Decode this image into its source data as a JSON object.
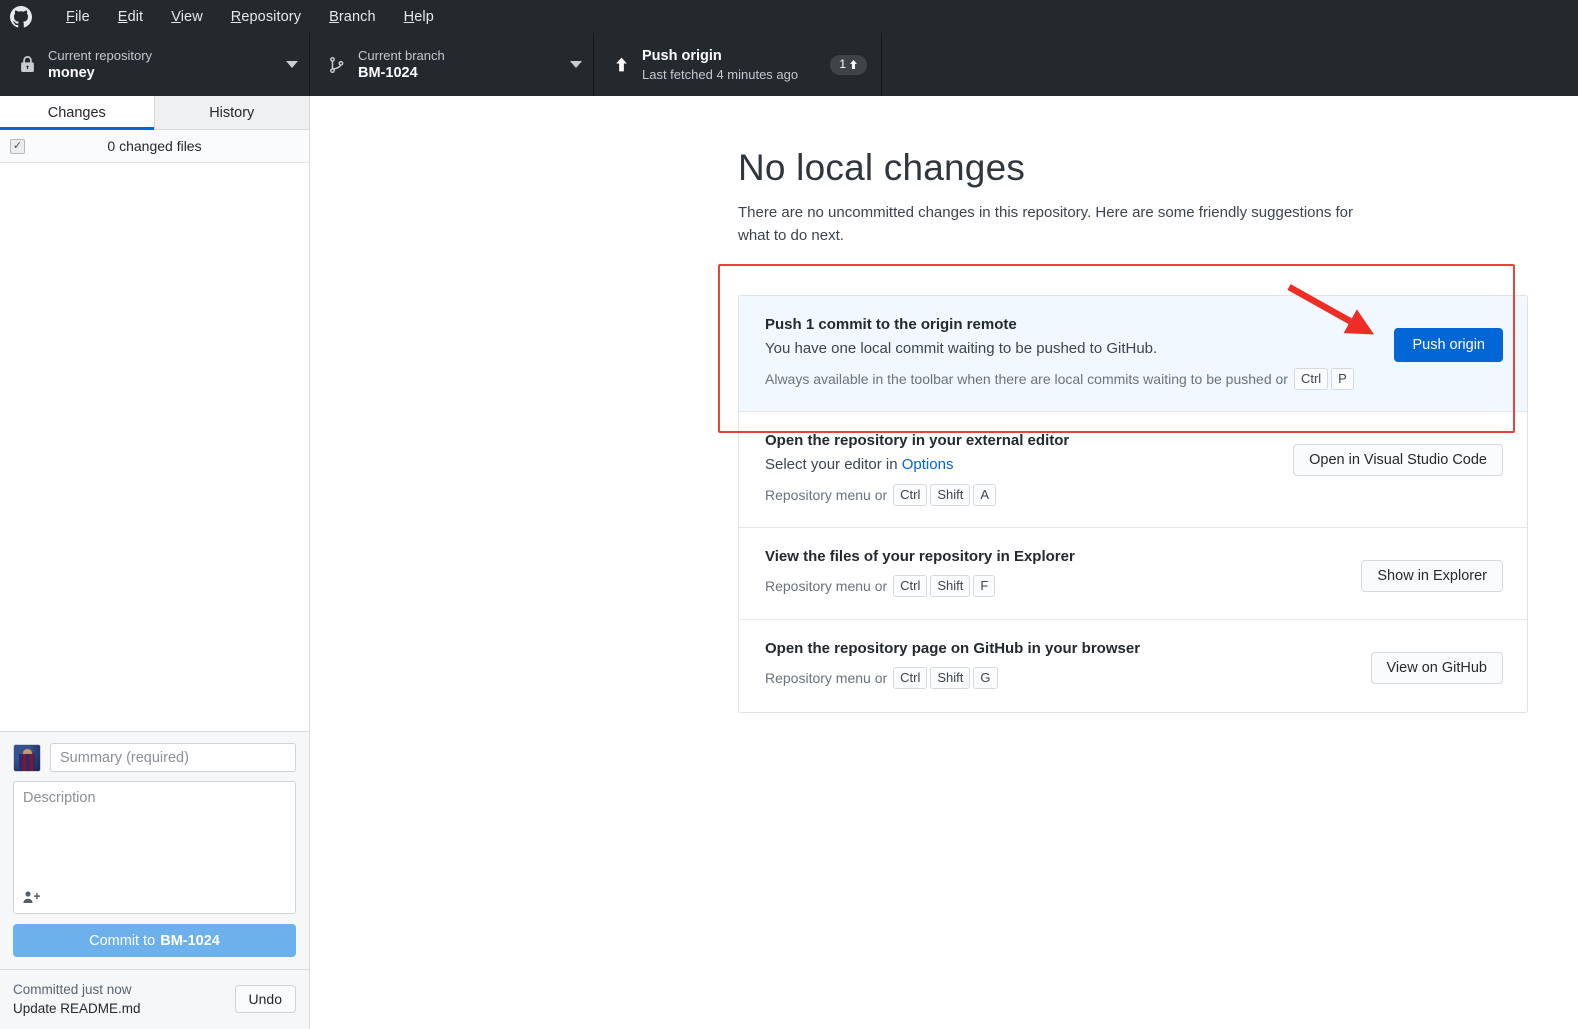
{
  "menubar": {
    "logo_icon": "github-mark-icon",
    "items": [
      {
        "label": "File",
        "mnemonic": "F",
        "rest": "ile"
      },
      {
        "label": "Edit",
        "mnemonic": "E",
        "rest": "dit"
      },
      {
        "label": "View",
        "mnemonic": "V",
        "rest": "iew"
      },
      {
        "label": "Repository",
        "mnemonic": "R",
        "rest": "epository"
      },
      {
        "label": "Branch",
        "mnemonic": "B",
        "rest": "ranch"
      },
      {
        "label": "Help",
        "mnemonic": "H",
        "rest": "elp"
      }
    ]
  },
  "toolbar": {
    "repository": {
      "icon": "lock-icon",
      "label": "Current repository",
      "value": "money",
      "caret_icon": "chevron-down-icon"
    },
    "branch": {
      "icon": "git-branch-icon",
      "label": "Current branch",
      "value": "BM-1024",
      "caret_icon": "chevron-down-icon"
    },
    "push": {
      "icon": "arrow-up-icon",
      "label": "Push origin",
      "sublabel": "Last fetched 4 minutes ago",
      "badge_count": "1",
      "badge_icon": "arrow-up-icon"
    }
  },
  "sidebar": {
    "tabs": [
      {
        "label": "Changes",
        "active": true
      },
      {
        "label": "History",
        "active": false
      }
    ],
    "changed_files": {
      "checkbox_state": "checked",
      "label": "0 changed files"
    },
    "commit_form": {
      "avatar_alt": "user-avatar",
      "summary_placeholder": "Summary (required)",
      "summary_value": "",
      "description_placeholder": "Description",
      "description_value": "",
      "coauthor_icon": "add-person-icon",
      "commit_button_prefix": "Commit to ",
      "commit_button_branch": "BM-1024"
    },
    "undo_bar": {
      "status": "Committed just now",
      "commit_message": "Update README.md",
      "undo_label": "Undo"
    }
  },
  "main": {
    "title": "No local changes",
    "subtitle": "There are no uncommitted changes in this repository. Here are some friendly suggestions for what to do next.",
    "illustration_name": "empty-boxes-illustration",
    "suggestions": [
      {
        "title": "Push 1 commit to the origin remote",
        "description": "You have one local commit waiting to be pushed to GitHub.",
        "hint_prefix": "Always available in the toolbar when there are local commits waiting to be pushed or",
        "hint_keys": [
          "Ctrl",
          "P"
        ],
        "button": "Push origin",
        "highlighted": true
      },
      {
        "title": "Open the repository in your external editor",
        "description_prefix": "Select your editor in ",
        "description_link": "Options",
        "hint_prefix": "Repository menu or",
        "hint_keys": [
          "Ctrl",
          "Shift",
          "A"
        ],
        "button": "Open in Visual Studio Code",
        "highlighted": false
      },
      {
        "title": "View the files of your repository in Explorer",
        "hint_prefix": "Repository menu or",
        "hint_keys": [
          "Ctrl",
          "Shift",
          "F"
        ],
        "button": "Show in Explorer",
        "highlighted": false
      },
      {
        "title": "Open the repository page on GitHub in your browser",
        "hint_prefix": "Repository menu or",
        "hint_keys": [
          "Ctrl",
          "Shift",
          "G"
        ],
        "button": "View on GitHub",
        "highlighted": false
      }
    ]
  },
  "annotations": {
    "highlight_box_color": "#e8443a",
    "arrow_color": "#ee2e24",
    "arrow_target": "Push origin"
  },
  "colors": {
    "toolbar_bg": "#24292e",
    "accent_blue": "#0366d6",
    "highlight_card_bg": "#f1f8ff",
    "commit_button": "#6cb1ec",
    "annotation_red": "#e8443a"
  }
}
